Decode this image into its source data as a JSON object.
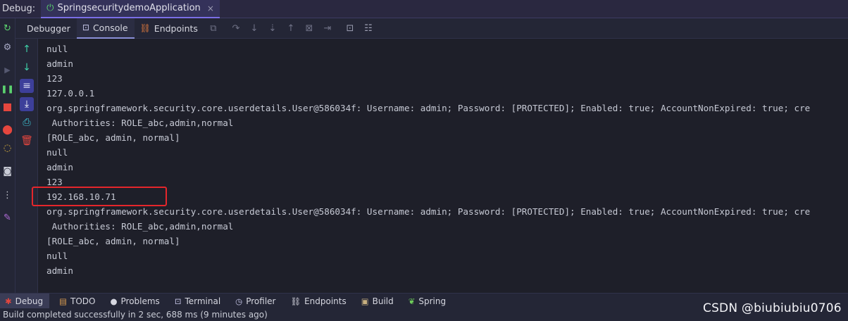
{
  "title_bar": {
    "prefix": "Debug:",
    "tab_label": "SpringsecuritydemoApplication",
    "close_glyph": "×"
  },
  "toolbar": {
    "tabs": [
      {
        "label": "Debugger"
      },
      {
        "label": "Console"
      },
      {
        "label": "Endpoints"
      }
    ]
  },
  "console": {
    "lines": [
      "null",
      "admin",
      "123",
      "127.0.0.1",
      "org.springframework.security.core.userdetails.User@586034f: Username: admin; Password: [PROTECTED]; Enabled: true; AccountNonExpired: true; cre",
      " Authorities: ROLE_abc,admin,normal",
      "[ROLE_abc, admin, normal]",
      "null",
      "admin",
      "123",
      "192.168.10.71",
      "org.springframework.security.core.userdetails.User@586034f: Username: admin; Password: [PROTECTED]; Enabled: true; AccountNonExpired: true; cre",
      " Authorities: ROLE_abc,admin,normal",
      "[ROLE_abc, admin, normal]",
      "null",
      "admin"
    ]
  },
  "bottom_tabs": [
    {
      "label": "Debug"
    },
    {
      "label": "TODO"
    },
    {
      "label": "Problems"
    },
    {
      "label": "Terminal"
    },
    {
      "label": "Profiler"
    },
    {
      "label": "Endpoints"
    },
    {
      "label": "Build"
    },
    {
      "label": "Spring"
    }
  ],
  "status": {
    "message": "Build completed successfully in 2 sec, 688 ms (9 minutes ago)"
  },
  "watermark": "CSDN @biubiubiu0706",
  "colors": {
    "highlight": "#e5262b",
    "accent": "#7a6ee6"
  }
}
